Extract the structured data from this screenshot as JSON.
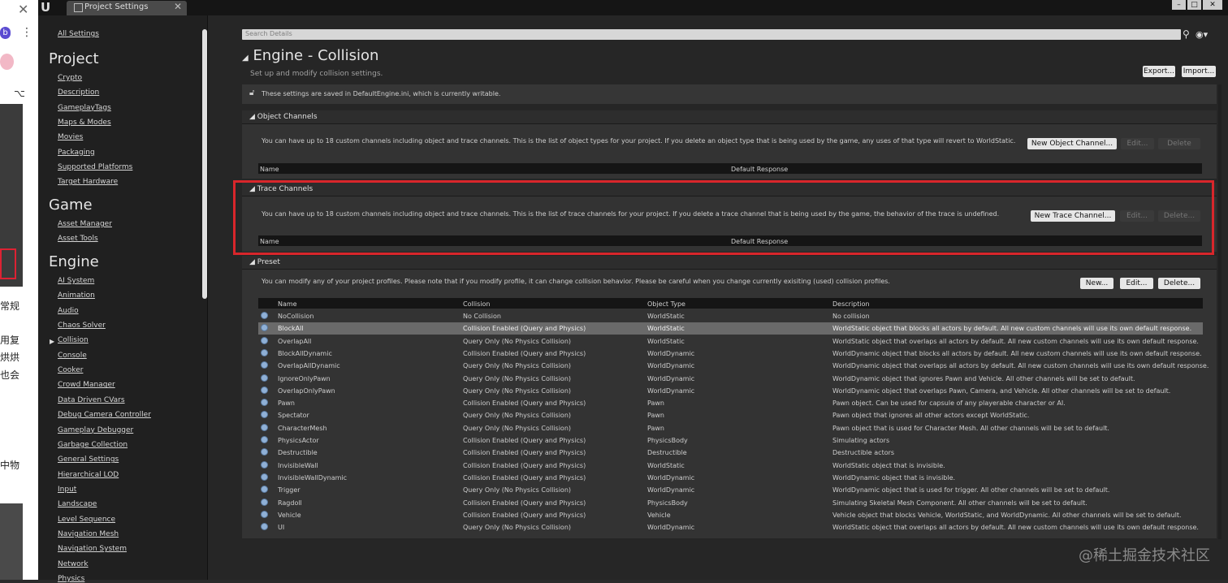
{
  "window": {
    "tab_title": "Project Settings",
    "tab_close": "✕",
    "logo": "U"
  },
  "sidebar": {
    "all_settings": "All Settings",
    "project_heading": "Project",
    "project_items": [
      "Crypto",
      "Description",
      "GameplayTags",
      "Maps & Modes",
      "Movies",
      "Packaging",
      "Supported Platforms",
      "Target Hardware"
    ],
    "game_heading": "Game",
    "game_items": [
      "Asset Manager",
      "Asset Tools"
    ],
    "engine_heading": "Engine",
    "engine_items": [
      "AI System",
      "Animation",
      "Audio",
      "Chaos Solver",
      "Collision",
      "Console",
      "Cooker",
      "Crowd Manager",
      "Data Driven CVars",
      "Debug Camera Controller",
      "Gameplay Debugger",
      "Garbage Collection",
      "General Settings",
      "Hierarchical LOD",
      "Input",
      "Landscape",
      "Level Sequence",
      "Navigation Mesh",
      "Navigation System",
      "Network",
      "Physics"
    ],
    "selected": "Collision"
  },
  "browser_strip": {
    "avatar_letter": "b",
    "cn_lines": [
      "常规",
      "用复",
      "烘烘",
      "也会",
      "中物"
    ]
  },
  "search": {
    "placeholder": "Search Details"
  },
  "header": {
    "title": "Engine - Collision",
    "subtitle": "Set up and modify collision settings.",
    "export_label": "Export...",
    "import_label": "Import..."
  },
  "notice": "These settings are saved in DefaultEngine.ini, which is currently writable.",
  "object_channels": {
    "title": "Object Channels",
    "description": "You can have up to 18 custom channels including object and trace channels. This is the list of object types for your project. If you delete an object type that is being used by the game, any uses of that type will revert to WorldStatic.",
    "new_label": "New Object Channel...",
    "edit_label": "Edit...",
    "delete_label": "Delete",
    "col_name": "Name",
    "col_response": "Default Response"
  },
  "trace_channels": {
    "title": "Trace Channels",
    "description": "You can have up to 18 custom channels including object and trace channels. This is the list of trace channels for your project. If you delete a trace channel that is being used by the game, the behavior of the trace is undefined.",
    "new_label": "New Trace Channel...",
    "edit_label": "Edit...",
    "delete_label": "Delete...",
    "col_name": "Name",
    "col_response": "Default Response"
  },
  "preset": {
    "title": "Preset",
    "description": "You can modify any of your project profiles. Please note that if you modify profile, it can change collision behavior. Please be careful when you change currently exisiting (used) collision profiles.",
    "new_label": "New...",
    "edit_label": "Edit...",
    "delete_label": "Delete...",
    "columns": [
      "Name",
      "Collision",
      "Object Type",
      "Description"
    ],
    "selected_index": 1,
    "rows": [
      [
        "NoCollision",
        "No Collision",
        "WorldStatic",
        "No collision"
      ],
      [
        "BlockAll",
        "Collision Enabled (Query and Physics)",
        "WorldStatic",
        "WorldStatic object that blocks all actors by default. All new custom channels will use its own default response."
      ],
      [
        "OverlapAll",
        "Query Only (No Physics Collision)",
        "WorldStatic",
        "WorldStatic object that overlaps all actors by default. All new custom channels will use its own default response."
      ],
      [
        "BlockAllDynamic",
        "Collision Enabled (Query and Physics)",
        "WorldDynamic",
        "WorldDynamic object that blocks all actors by default. All new custom channels will use its own default response."
      ],
      [
        "OverlapAllDynamic",
        "Query Only (No Physics Collision)",
        "WorldDynamic",
        "WorldDynamic object that overlaps all actors by default. All new custom channels will use its own default response."
      ],
      [
        "IgnoreOnlyPawn",
        "Query Only (No Physics Collision)",
        "WorldDynamic",
        "WorldDynamic object that ignores Pawn and Vehicle. All other channels will be set to default."
      ],
      [
        "OverlapOnlyPawn",
        "Query Only (No Physics Collision)",
        "WorldDynamic",
        "WorldDynamic object that overlaps Pawn, Camera, and Vehicle. All other channels will be set to default."
      ],
      [
        "Pawn",
        "Collision Enabled (Query and Physics)",
        "Pawn",
        "Pawn object. Can be used for capsule of any playerable character or AI."
      ],
      [
        "Spectator",
        "Query Only (No Physics Collision)",
        "Pawn",
        "Pawn object that ignores all other actors except WorldStatic."
      ],
      [
        "CharacterMesh",
        "Query Only (No Physics Collision)",
        "Pawn",
        "Pawn object that is used for Character Mesh. All other channels will be set to default."
      ],
      [
        "PhysicsActor",
        "Collision Enabled (Query and Physics)",
        "PhysicsBody",
        "Simulating actors"
      ],
      [
        "Destructible",
        "Collision Enabled (Query and Physics)",
        "Destructible",
        "Destructible actors"
      ],
      [
        "InvisibleWall",
        "Collision Enabled (Query and Physics)",
        "WorldStatic",
        "WorldStatic object that is invisible."
      ],
      [
        "InvisibleWallDynamic",
        "Collision Enabled (Query and Physics)",
        "WorldDynamic",
        "WorldDynamic object that is invisible."
      ],
      [
        "Trigger",
        "Query Only (No Physics Collision)",
        "WorldDynamic",
        "WorldDynamic object that is used for trigger. All other channels will be set to default."
      ],
      [
        "Ragdoll",
        "Collision Enabled (Query and Physics)",
        "PhysicsBody",
        "Simulating Skeletal Mesh Component. All other channels will be set to default."
      ],
      [
        "Vehicle",
        "Collision Enabled (Query and Physics)",
        "Vehicle",
        "Vehicle object that blocks Vehicle, WorldStatic, and WorldDynamic. All other channels will be set to default."
      ],
      [
        "UI",
        "Query Only (No Physics Collision)",
        "WorldDynamic",
        "WorldStatic object that overlaps all actors by default. All new custom channels will use its own default response."
      ]
    ]
  },
  "watermark": "@稀土掘金技术社区",
  "icons": {
    "search": "search-icon",
    "eye": "eye-icon",
    "lock": "lock-icon",
    "row": "preset-profile-icon"
  }
}
